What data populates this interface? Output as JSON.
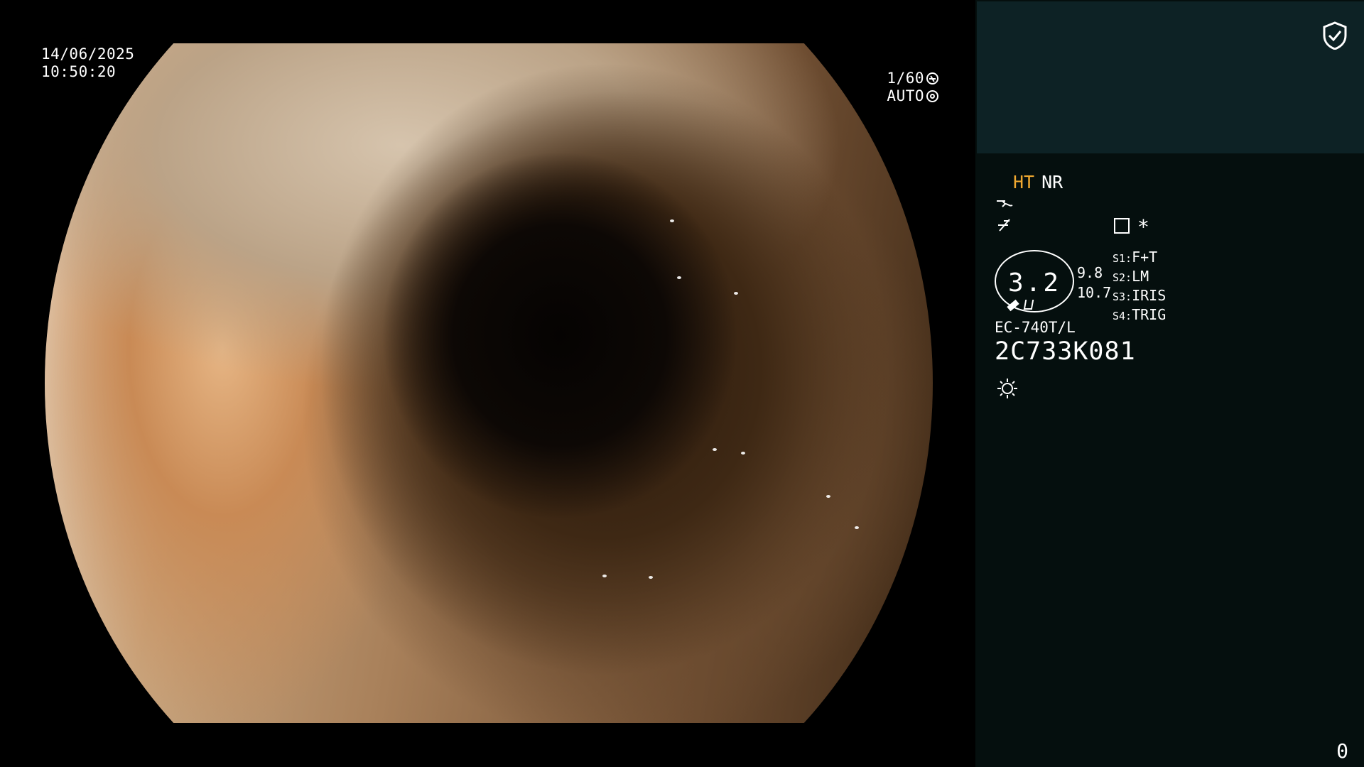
{
  "overlay": {
    "date": "14/06/2025",
    "time": "10:50:20",
    "shutter": "1/60",
    "exposure_mode": "AUTO",
    "shutter_icon": "shutter-icon",
    "iris_icon": "iris-icon"
  },
  "panel": {
    "status_icon": "shield-check-icon",
    "mode_primary": "HT",
    "mode_secondary": "NR",
    "mode_primary_color": "#f0a830",
    "gauge_value": "3.2",
    "scale_top": "9.8",
    "scale_bottom": "10.7",
    "switches": [
      {
        "key": "S1:",
        "value": "F+T"
      },
      {
        "key": "S2:",
        "value": "LM"
      },
      {
        "key": "S3:",
        "value": "IRIS"
      },
      {
        "key": "S4:",
        "value": "TRIG"
      }
    ],
    "asterisk": "*",
    "scope_model": "EC-740T/L",
    "scope_serial": "2C733K081",
    "counter": "0"
  },
  "colors": {
    "panel_bg": "#050f0e",
    "panel_header_bg": "#0d2225",
    "accent": "#f0a830"
  }
}
